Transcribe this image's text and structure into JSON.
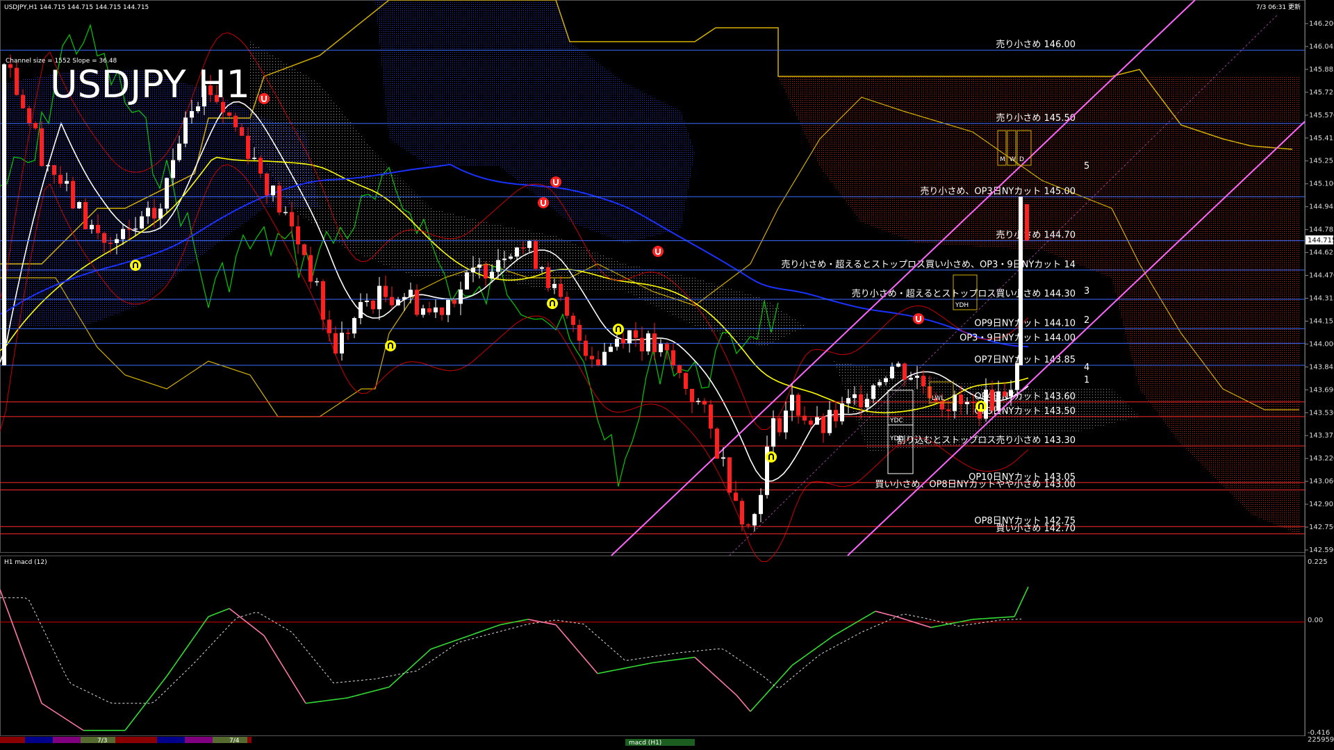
{
  "header": {
    "symbol_line": "USDJPY,H1  144.715 144.715 144.715 144.715",
    "timestamp": "7/3 06:31 更新",
    "channel_info": "Channel size = 1552 Slope = 36.48",
    "big_title": "USDJPY H1"
  },
  "colors": {
    "background": "#000000",
    "candle_up": "#ffffff",
    "candle_down": "#ff2020",
    "level_blue": "#3a6cff",
    "level_red": "#ff2a2a",
    "channel": "#ff66ff",
    "ma_white": "#ffffff",
    "ma_yellow": "#ffff00",
    "ma_blue": "#1a32ff",
    "chikou_green": "#00cc00",
    "cloud_gold": "#d4b000",
    "macd_up": "#33dd33",
    "macd_down": "#ff77aa"
  },
  "price_axis": {
    "labels": [
      "146.200",
      "146.045",
      "145.885",
      "145.725",
      "145.570",
      "145.415",
      "145.255",
      "145.100",
      "144.945",
      "144.785",
      "144.625",
      "144.470",
      "144.315",
      "144.155",
      "144.000",
      "143.845",
      "143.690",
      "143.530",
      "143.375",
      "143.220",
      "143.060",
      "142.905",
      "142.750",
      "142.590"
    ],
    "current_price": "144.715"
  },
  "chart_data": {
    "type": "candlestick",
    "symbol": "USDJPY",
    "timeframe": "H1",
    "ylim": [
      142.59,
      146.2
    ],
    "current_price": 144.715,
    "levels": [
      {
        "label": "売り小さめ 146.00",
        "price": 146.0,
        "color": "#3a6cff"
      },
      {
        "label": "売り小さめ 145.50",
        "price": 145.5,
        "color": "#3a6cff"
      },
      {
        "label": "売り小さめ、OP3日NYカット 145.00",
        "price": 145.0,
        "color": "#3a6cff"
      },
      {
        "label": "売り小さめ 144.70",
        "price": 144.7,
        "color": "#3a6cff"
      },
      {
        "label": "売り小さめ・超えるとストップロス買い小さめ、OP3・9日NYカット 14",
        "price": 144.5,
        "color": "#3a6cff"
      },
      {
        "label": "売り小さめ・超えるとストップロス買い小さめ 144.30",
        "price": 144.3,
        "color": "#3a6cff"
      },
      {
        "label": "OP9日NYカット 144.10",
        "price": 144.1,
        "color": "#3a6cff"
      },
      {
        "label": "OP3・9日NYカット 144.00",
        "price": 144.0,
        "color": "#3a6cff"
      },
      {
        "label": "OP7日NYカット 143.85",
        "price": 143.85,
        "color": "#3a6cff"
      },
      {
        "label": "OP4日NYカット 143.60",
        "price": 143.6,
        "color": "#ff2a2a"
      },
      {
        "label": "OP3日NYカット 143.50",
        "price": 143.5,
        "color": "#ff2a2a"
      },
      {
        "label": "割り込むとストップロス売り小さめ 143.30",
        "price": 143.3,
        "color": "#ff2a2a"
      },
      {
        "label": "OP10日NYカット 143.05",
        "price": 143.05,
        "color": "#ff2a2a"
      },
      {
        "label": "買い小さめ、OP8日NYカットやや小さめ 143.00",
        "price": 143.0,
        "color": "#ff2a2a"
      },
      {
        "label": "OP8日NYカット 142.75",
        "price": 142.75,
        "color": "#ff2a2a"
      },
      {
        "label": "買い小さめ 142.70",
        "price": 142.7,
        "color": "#ff2a2a"
      }
    ],
    "channel_numbers": [
      "5",
      "3",
      "2",
      "4",
      "1"
    ],
    "boxes": [
      "YDH",
      "YDC",
      "YDO",
      "LWL",
      "M",
      "W",
      "D"
    ],
    "macd": {
      "label": "H1  macd (12)",
      "ylim": [
        -0.416,
        0.225
      ],
      "axis_labels": [
        "0.225",
        "0.00",
        "-0.416"
      ]
    },
    "time_axis": {
      "labels": [
        "7/3",
        "7/4"
      ]
    },
    "footer_right": "225959",
    "footer_label": "macd (H1)"
  }
}
